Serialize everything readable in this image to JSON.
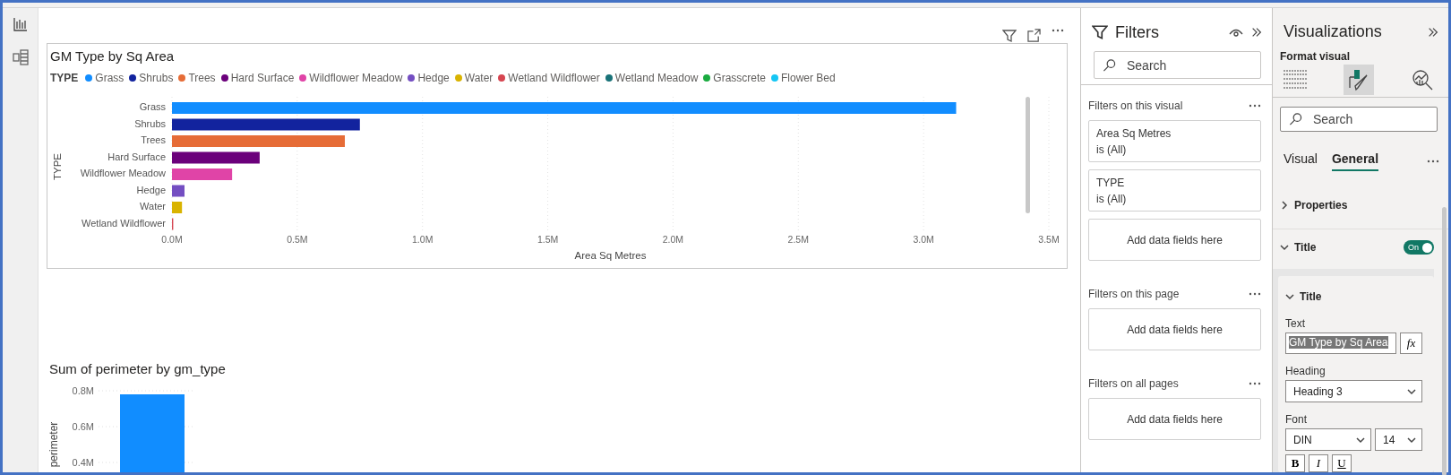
{
  "visual_1": {
    "title": "GM Type by Sq Area",
    "legend": {
      "title": "TYPE",
      "items": [
        {
          "label": "Grass",
          "color": "#118dff"
        },
        {
          "label": "Shrubs",
          "color": "#12239e"
        },
        {
          "label": "Trees",
          "color": "#e66c37"
        },
        {
          "label": "Hard Surface",
          "color": "#6b007b"
        },
        {
          "label": "Wildflower Meadow",
          "color": "#e044a7"
        },
        {
          "label": "Hedge",
          "color": "#744ec2"
        },
        {
          "label": "Water",
          "color": "#d9b300"
        },
        {
          "label": "Wetland Wildflower",
          "color": "#d64550"
        },
        {
          "label": "Wetland Meadow",
          "color": "#197278"
        },
        {
          "label": "Grasscrete",
          "color": "#1aab40"
        },
        {
          "label": "Flower Bed",
          "color": "#15c6f4"
        }
      ]
    },
    "chart_data": {
      "type": "bar",
      "orientation": "horizontal",
      "xlabel": "Area Sq Metres",
      "ylabel": "TYPE",
      "categories": [
        "Grass",
        "Shrubs",
        "Trees",
        "Hard Surface",
        "Wildflower Meadow",
        "Hedge",
        "Water",
        "Wetland Wildflower"
      ],
      "grid": true,
      "series": [
        {
          "values": [
            3.13,
            0.75,
            0.69,
            0.35,
            0.24,
            0.05,
            0.04,
            0.005
          ]
        }
      ],
      "xlim": [
        0,
        3.5
      ],
      "xticks": [
        {
          "value": 0,
          "label": "0.0M"
        },
        {
          "value": 0.5,
          "label": "0.5M"
        },
        {
          "value": 1,
          "label": "1.0M"
        },
        {
          "value": 1.5,
          "label": "1.5M"
        },
        {
          "value": 2,
          "label": "2.0M"
        },
        {
          "value": 2.5,
          "label": "2.5M"
        },
        {
          "value": 3,
          "label": "3.0M"
        },
        {
          "value": 3.5,
          "label": "3.5M"
        }
      ]
    }
  },
  "visual_2": {
    "title": "Sum of perimeter by gm_type",
    "chart_data": {
      "type": "bar",
      "ylabel": "perimeter",
      "grid": true,
      "ylim": [
        0,
        0.8
      ],
      "series": [
        {
          "color": "#118dff",
          "values": [
            0.78
          ]
        }
      ],
      "yticks": [
        {
          "value": 0.4,
          "label": "0.4M"
        },
        {
          "value": 0.6,
          "label": "0.6M"
        },
        {
          "value": 0.8,
          "label": "0.8M"
        }
      ]
    }
  },
  "filters": {
    "title": "Filters",
    "search": {
      "placeholder": "Search"
    },
    "sections": [
      {
        "title": "Filters on this visual",
        "cards": [
          {
            "kind": "filter",
            "field": "Area Sq Metres",
            "condition": "is (All)"
          },
          {
            "kind": "filter",
            "field": "TYPE",
            "condition": "is (All)"
          },
          {
            "kind": "drop",
            "label": "Add data fields here"
          }
        ]
      },
      {
        "title": "Filters on this page",
        "cards": [
          {
            "kind": "drop",
            "label": "Add data fields here"
          }
        ]
      },
      {
        "title": "Filters on all pages",
        "cards": [
          {
            "kind": "drop",
            "label": "Add data fields here"
          }
        ]
      }
    ]
  },
  "visualizations": {
    "title": "Visualizations",
    "subtitle": "Format visual",
    "modes": [
      {
        "kind": "build",
        "selected": false
      },
      {
        "kind": "format",
        "selected": true
      },
      {
        "kind": "analytics",
        "selected": false
      }
    ],
    "search": {
      "placeholder": "Search"
    },
    "tabs": [
      {
        "label": "Visual",
        "selected": false
      },
      {
        "label": "General",
        "selected": true
      }
    ],
    "groups": [
      {
        "label": "Properties",
        "expanded": false
      },
      {
        "label": "Title",
        "expanded": true,
        "toggle": {
          "on": true,
          "label": "On"
        }
      }
    ],
    "title_card": {
      "heading": "Title",
      "expanded": true,
      "text_label": "Text",
      "text_value": "GM Type by Sq Area",
      "text_selected": true,
      "fx": "fx",
      "heading_label": "Heading",
      "heading_value": "Heading 3",
      "font_label": "Font",
      "font_value": "DIN",
      "size_value": "14",
      "format_buttons": [
        "B",
        "I",
        "U"
      ]
    }
  }
}
